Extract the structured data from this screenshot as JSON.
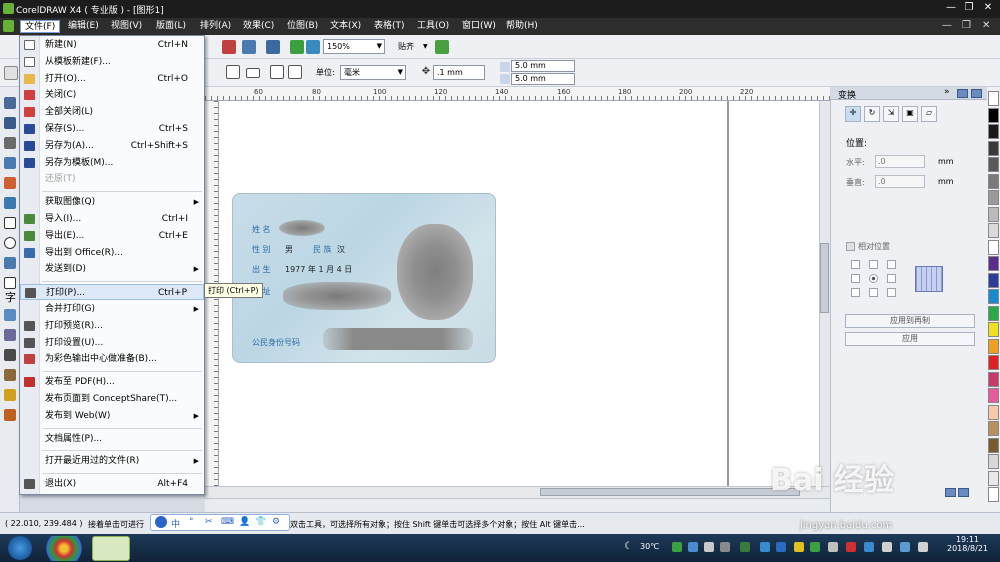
{
  "window": {
    "title": "CorelDRAW X4 ( 专业版 ) - [图形1]"
  },
  "menubar": [
    "文件(F)",
    "编辑(E)",
    "视图(V)",
    "版面(L)",
    "排列(A)",
    "效果(C)",
    "位图(B)",
    "文本(X)",
    "表格(T)",
    "工具(O)",
    "窗口(W)",
    "帮助(H)"
  ],
  "toolbar": {
    "zoom": "150%",
    "snap": "贴齐",
    "unit_label": "单位:",
    "unit": "毫米",
    "nudge": ".1 mm",
    "dup_x": "5.0 mm",
    "dup_y": "5.0 mm"
  },
  "file_menu": [
    {
      "label": "新建(N)",
      "shortcut": "Ctrl+N",
      "icon_color": "#ffffff"
    },
    {
      "label": "从模板新建(F)...",
      "shortcut": "",
      "icon_color": "#ffffff"
    },
    {
      "label": "打开(O)...",
      "shortcut": "Ctrl+O",
      "icon_color": "#e8b84a"
    },
    {
      "label": "关闭(C)",
      "shortcut": "",
      "icon_color": "#d04040"
    },
    {
      "label": "全部关闭(L)",
      "shortcut": "",
      "icon_color": "#d04040"
    },
    {
      "label": "保存(S)...",
      "shortcut": "Ctrl+S",
      "icon_color": "#2a4a9a"
    },
    {
      "label": "另存为(A)...",
      "shortcut": "Ctrl+Shift+S",
      "icon_color": "#2a4a9a"
    },
    {
      "label": "另存为模板(M)...",
      "shortcut": "",
      "icon_color": "#2a4a9a"
    },
    {
      "label": "还原(T)",
      "shortcut": "",
      "disabled": true
    }
  ],
  "file_menu_2": [
    {
      "label": "获取图像(Q)",
      "submenu": true
    },
    {
      "label": "导入(I)...",
      "shortcut": "Ctrl+I",
      "icon_color": "#4a8a3a"
    },
    {
      "label": "导出(E)...",
      "shortcut": "Ctrl+E",
      "icon_color": "#4a8a3a"
    },
    {
      "label": "导出到 Office(R)...",
      "shortcut": "",
      "icon_color": "#3a6ab0"
    },
    {
      "label": "发送到(D)",
      "submenu": true
    }
  ],
  "file_menu_3": [
    {
      "label": "打印(P)...",
      "shortcut": "Ctrl+P",
      "icon_color": "#555555",
      "hover": true
    },
    {
      "label": "合并打印(G)",
      "submenu": true
    },
    {
      "label": "打印预览(R)...",
      "shortcut": "",
      "icon_color": "#555555"
    },
    {
      "label": "打印设置(U)...",
      "shortcut": "",
      "icon_color": "#555555"
    },
    {
      "label": "为彩色输出中心做准备(B)...",
      "shortcut": "",
      "icon_color": "#c04040"
    }
  ],
  "file_menu_4": [
    {
      "label": "发布至 PDF(H)...",
      "shortcut": "",
      "icon_color": "#c03030"
    },
    {
      "label": "发布页面到 ConceptShare(T)...",
      "shortcut": ""
    },
    {
      "label": "发布到 Web(W)",
      "submenu": true
    }
  ],
  "file_menu_5": [
    {
      "label": "文档属性(P)...",
      "shortcut": ""
    }
  ],
  "file_menu_6": [
    {
      "label": "打开最近用过的文件(R)",
      "submenu": true
    }
  ],
  "file_menu_7": [
    {
      "label": "退出(X)",
      "shortcut": "Alt+F4",
      "icon_color": "#555555"
    }
  ],
  "tooltip": "打印 (Ctrl+P)",
  "ruler_h": [
    "60",
    "80",
    "100",
    "120",
    "140",
    "160",
    "180",
    "200",
    "220"
  ],
  "ruler_v": [],
  "id_card": {
    "name_label": "姓 名",
    "sex_label": "性 别",
    "sex_value": "男",
    "nation_label": "民 族",
    "nation_value": "汉",
    "birth_label": "出 生",
    "birth_value": "1977 年 1 月 4 日",
    "addr_label": "住 址",
    "id_label": "公民身份号码"
  },
  "docker": {
    "title": "变换",
    "position_label": "位置:",
    "h_label": "水平:",
    "h_value": ".0",
    "v_label": "垂直:",
    "v_value": ".0",
    "unit": "mm",
    "relative_label": "相对位置",
    "apply_copy": "应用到再制",
    "apply": "应用"
  },
  "palette": [
    "#ffffff",
    "#000000",
    "#1a1a1a",
    "#3a3a3a",
    "#5a5a5a",
    "#7a7a7a",
    "#9a9a9a",
    "#bababa",
    "#dadada",
    "#ffffff",
    "#5a2d8a",
    "#2a3d9a",
    "#1a8ad0",
    "#2aa84a",
    "#f0e020",
    "#f0a020",
    "#e02020",
    "#c83a6a",
    "#e85a9a",
    "#f8c8a8",
    "#b89060",
    "#7a5a30",
    "#d8d8d8",
    "#e8e8e8",
    "#ffffff"
  ],
  "status": {
    "coords": "( 22.010, 239.484 )",
    "message": "接着单击可进行",
    "message2": "双击工具，可选择所有对象；按住 Shift 键单击可选择多个对象；按住 Alt 键单击..."
  },
  "ime": [
    "中",
    "°",
    "✂",
    "⌨",
    "👤",
    "👕",
    "⚙"
  ],
  "taskbar": {
    "temp": "30℃",
    "time": "19:11",
    "date": "2018/8/21"
  },
  "watermark": "Bai 经验",
  "watermark_url": "jingyan.baidu.com"
}
